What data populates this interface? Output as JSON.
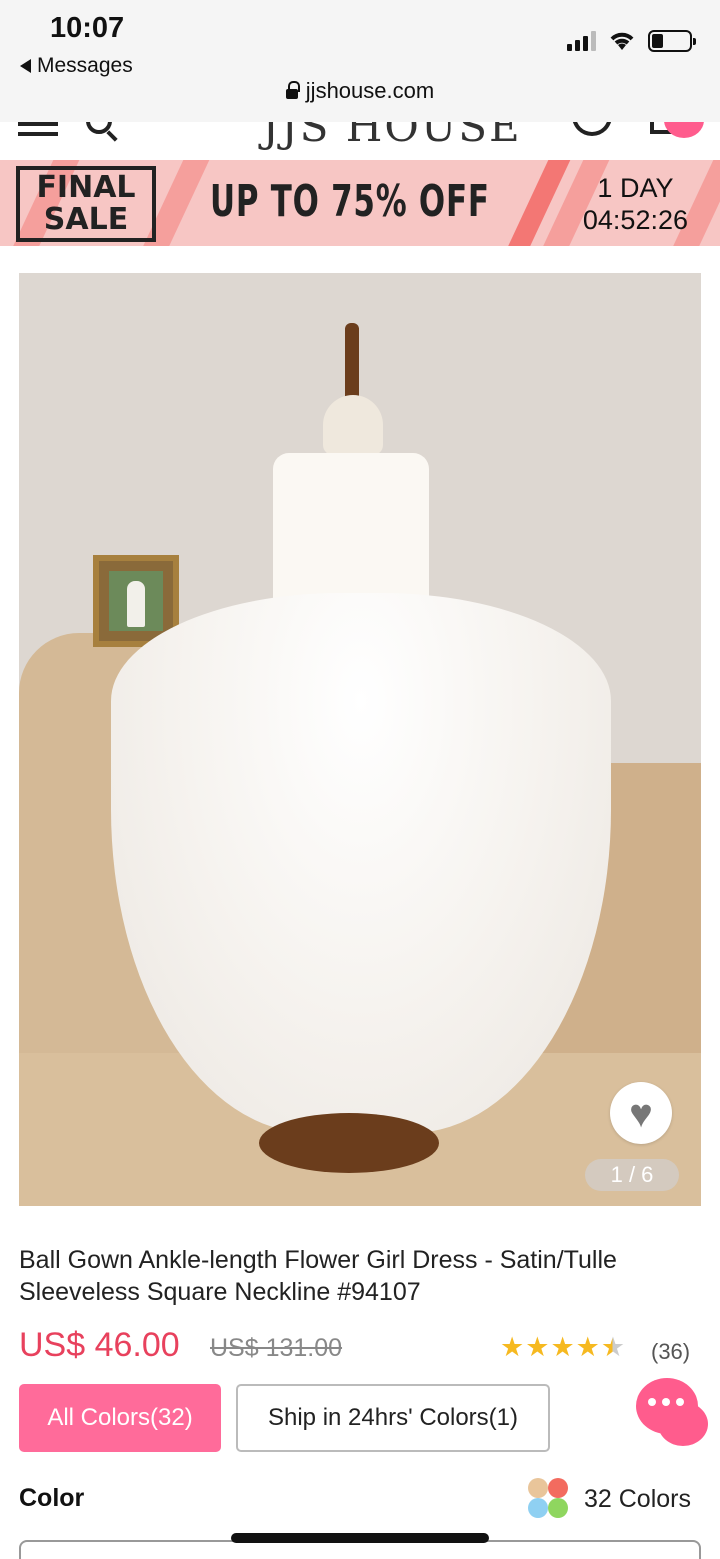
{
  "status_bar": {
    "time": "10:07",
    "back_label": "Messages",
    "url": "jjshouse.com"
  },
  "header": {
    "logo_text": "JJS HOUSE"
  },
  "promo": {
    "badge_line1": "FINAL",
    "badge_line2": "SALE",
    "headline": "UP TO 75% OFF",
    "countdown_days": "1 DAY",
    "countdown_time": "04:52:26"
  },
  "gallery": {
    "counter": "1 / 6"
  },
  "product": {
    "title": "Ball Gown Ankle-length Flower Girl Dress - Satin/Tulle Sleeveless Square Neckline #94107",
    "price": "US$ 46.00",
    "old_price": "US$ 131.00",
    "rating": 4.5,
    "review_count": "(36)"
  },
  "color_filters": {
    "all_colors": "All Colors(32)",
    "ship_colors": "Ship in 24hrs' Colors(1)"
  },
  "color_section": {
    "label": "Color",
    "count": "32 Colors"
  },
  "colors": {
    "accent": "#ff6b9a",
    "price_red": "#e8415d",
    "star": "#f6b920",
    "promo_bg": "#f7c6c4"
  }
}
